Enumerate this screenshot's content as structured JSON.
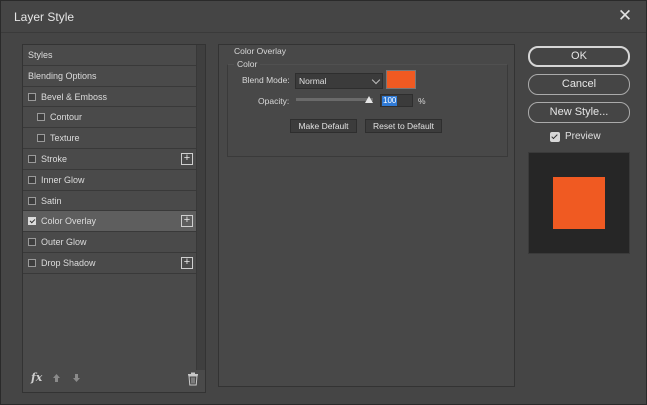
{
  "window": {
    "title": "Layer Style",
    "close": "✕"
  },
  "styles_list": {
    "items": [
      {
        "label": "Styles",
        "checkbox": false,
        "checked": false,
        "plus": false,
        "indent": false,
        "active": false
      },
      {
        "label": "Blending Options",
        "checkbox": false,
        "checked": false,
        "plus": false,
        "indent": false,
        "active": false
      },
      {
        "label": "Bevel & Emboss",
        "checkbox": true,
        "checked": false,
        "plus": false,
        "indent": false,
        "active": false
      },
      {
        "label": "Contour",
        "checkbox": true,
        "checked": false,
        "plus": false,
        "indent": true,
        "active": false
      },
      {
        "label": "Texture",
        "checkbox": true,
        "checked": false,
        "plus": false,
        "indent": true,
        "active": false
      },
      {
        "label": "Stroke",
        "checkbox": true,
        "checked": false,
        "plus": true,
        "indent": false,
        "active": false
      },
      {
        "label": "Inner Glow",
        "checkbox": true,
        "checked": false,
        "plus": false,
        "indent": false,
        "active": false
      },
      {
        "label": "Satin",
        "checkbox": true,
        "checked": false,
        "plus": false,
        "indent": false,
        "active": false
      },
      {
        "label": "Color Overlay",
        "checkbox": true,
        "checked": true,
        "plus": true,
        "indent": false,
        "active": true
      },
      {
        "label": "Outer Glow",
        "checkbox": true,
        "checked": false,
        "plus": false,
        "indent": false,
        "active": false
      },
      {
        "label": "Drop Shadow",
        "checkbox": true,
        "checked": false,
        "plus": true,
        "indent": false,
        "active": false
      }
    ],
    "footer": {
      "fx_label": "fx",
      "up_icon": "arrow-up-icon",
      "down_icon": "arrow-down-icon",
      "trash_icon": "trash-icon"
    }
  },
  "color_overlay": {
    "group_title": "Color Overlay",
    "sub_title": "Color",
    "blend_mode_label": "Blend Mode:",
    "blend_mode_value": "Normal",
    "overlay_color": "#f05a22",
    "opacity_label": "Opacity:",
    "opacity_value": "100",
    "opacity_unit": "%",
    "make_default": "Make Default",
    "reset_default": "Reset to Default"
  },
  "actions": {
    "ok": "OK",
    "cancel": "Cancel",
    "new_style": "New Style..."
  },
  "preview": {
    "label": "Preview",
    "checked": true,
    "swatch_color": "#f05a22"
  }
}
